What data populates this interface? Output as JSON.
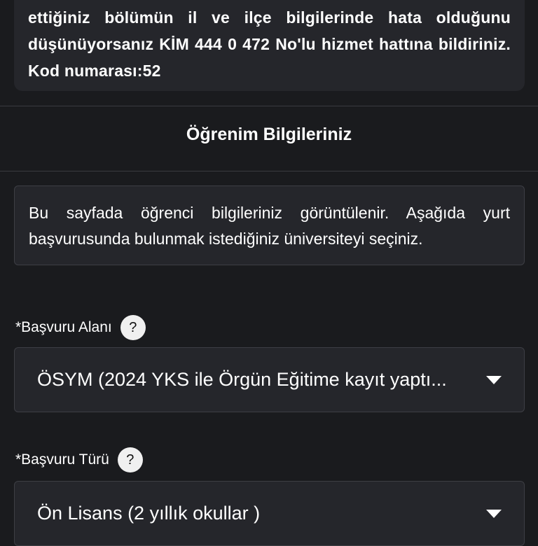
{
  "notice": {
    "text": "ettiğiniz bölümün il ve ilçe bilgilerinde hata olduğunu düşünüyorsanız KİM 444 0 472 No'lu hizmet hattına bildiriniz. Kod numarası:52"
  },
  "section": {
    "title": "Öğrenim Bilgileriniz"
  },
  "info": {
    "text": "Bu sayfada öğrenci bilgileriniz görüntülenir. Aşağıda yurt başvurusunda bulunmak istediğiniz üniversiteyi seçiniz."
  },
  "fields": {
    "basvuru_alani": {
      "label": "*Başvuru Alanı",
      "help": "?",
      "value": "ÖSYM (2024 YKS ile Örgün Eğitime kayıt yaptı..."
    },
    "basvuru_turu": {
      "label": "*Başvuru Türü",
      "help": "?",
      "value": "Ön Lisans (2 yıllık okullar )"
    }
  },
  "colors": {
    "background": "#1a1b1e",
    "card": "#25262b",
    "border": "#3d3e44",
    "text": "#ffffff"
  }
}
